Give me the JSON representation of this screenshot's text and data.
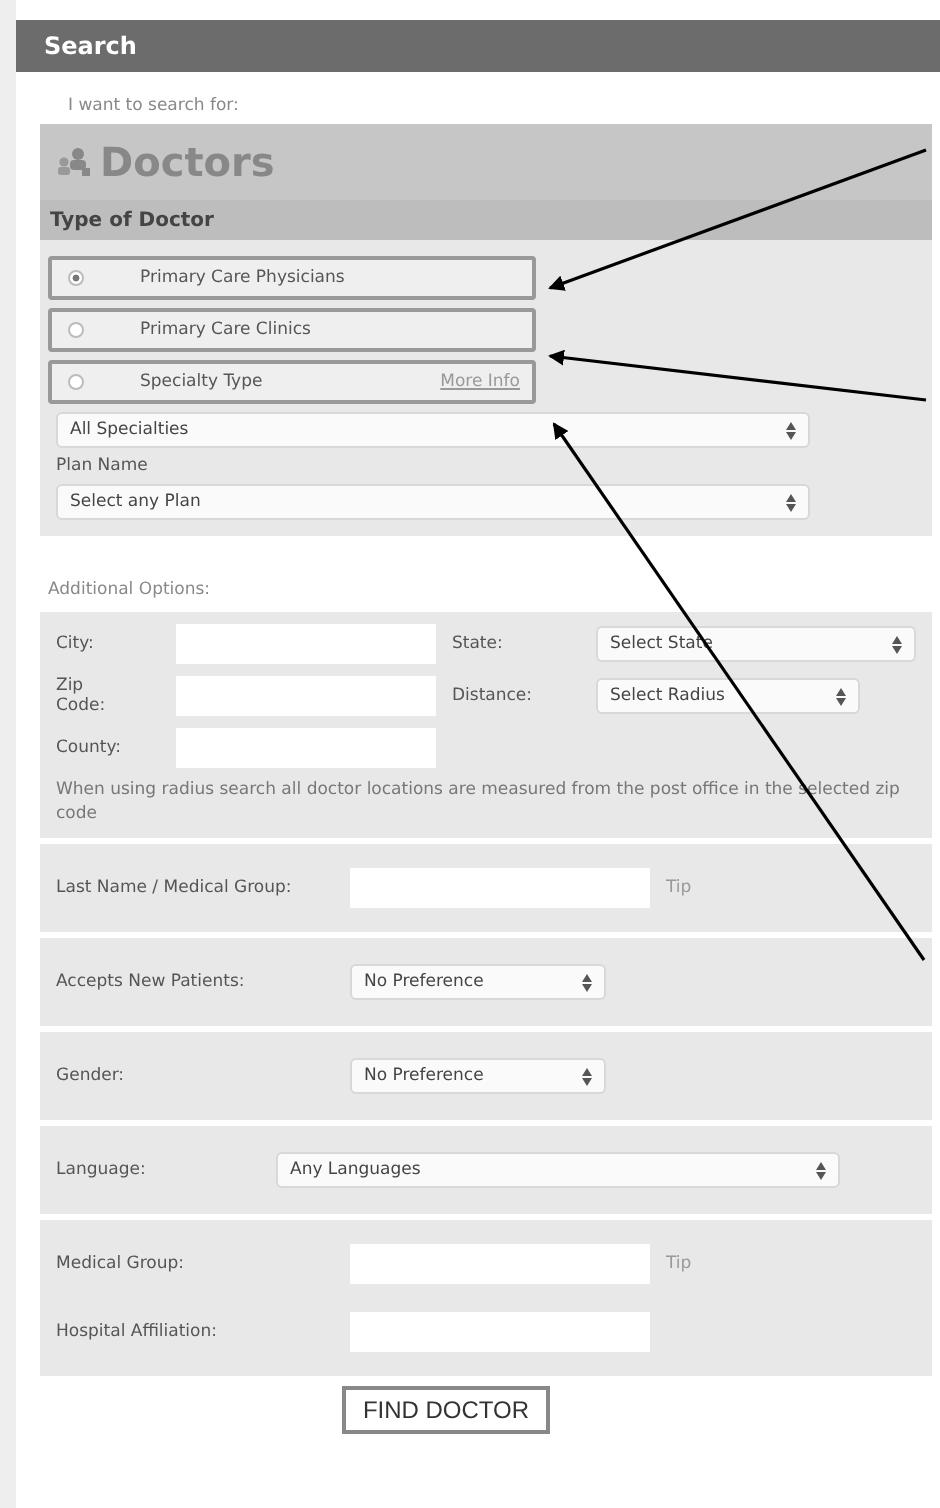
{
  "header": {
    "title": "Search"
  },
  "search_for": {
    "label": "I want to search for:",
    "category": "Doctors"
  },
  "type_of_doctor": {
    "heading": "Type of Doctor",
    "options": [
      {
        "label": "Primary Care Physicians",
        "selected": true
      },
      {
        "label": "Primary Care Clinics",
        "selected": false
      },
      {
        "label": "Specialty Type",
        "selected": false,
        "link": "More Info"
      }
    ]
  },
  "specialty_select": {
    "value": "All Specialties"
  },
  "plan": {
    "label": "Plan Name",
    "value": "Select any Plan"
  },
  "additional_options": {
    "label": "Additional Options:",
    "city": {
      "label": "City:"
    },
    "state": {
      "label": "State:",
      "value": "Select State"
    },
    "zip": {
      "label": "Zip Code:"
    },
    "distance": {
      "label": "Distance:",
      "value": "Select Radius"
    },
    "county": {
      "label": "County:"
    },
    "note": "When using radius search all doctor locations are measured from the post office in the selected zip code"
  },
  "sections": [
    {
      "rows": [
        {
          "kind": "input",
          "label": "Last Name / Medical Group:",
          "tip": "Tip"
        }
      ]
    },
    {
      "rows": [
        {
          "kind": "select",
          "label": "Accepts New Patients:",
          "value": "No Preference"
        }
      ]
    },
    {
      "rows": [
        {
          "kind": "select",
          "label": "Gender:",
          "value": "No Preference"
        }
      ]
    },
    {
      "rows": [
        {
          "kind": "wide-select",
          "label": "Language:",
          "value": "Any Languages"
        }
      ]
    },
    {
      "rows": [
        {
          "kind": "input",
          "label": "Medical Group:",
          "tip": "Tip"
        },
        {
          "kind": "input",
          "label": "Hospital Affiliation:"
        }
      ]
    }
  ],
  "button": "FIND DOCTOR"
}
